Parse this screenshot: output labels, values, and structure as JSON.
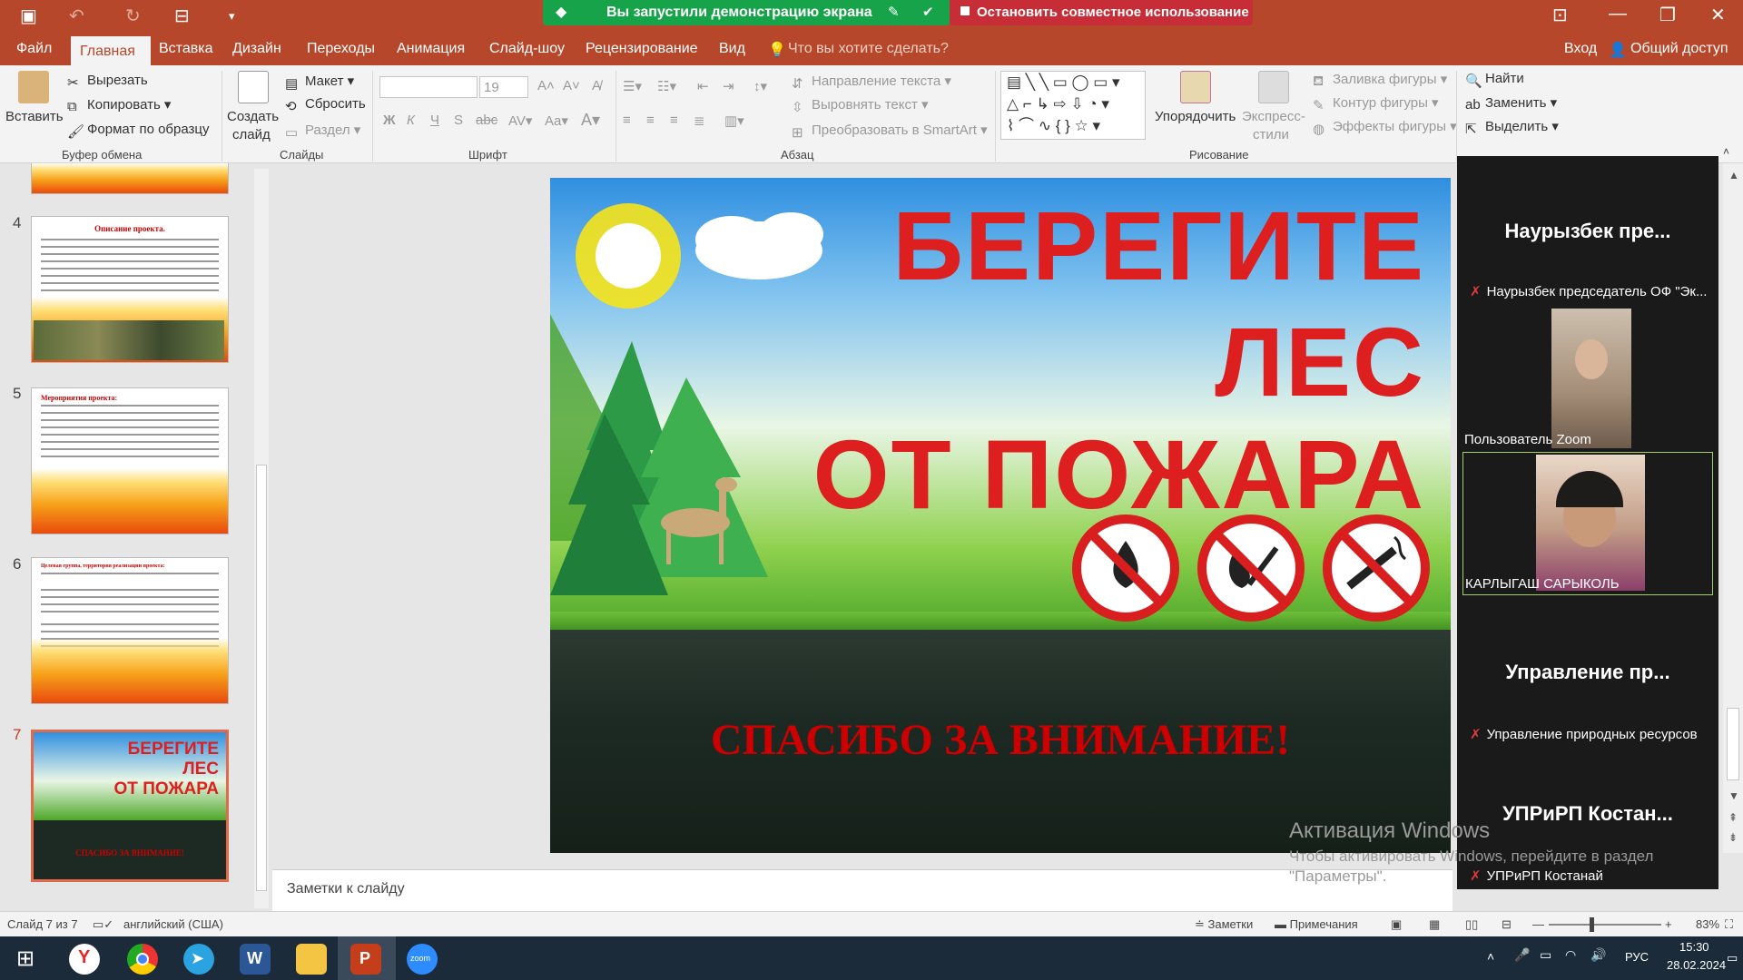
{
  "share_bar": {
    "status": "Вы запустили демонстрацию экрана",
    "stop": "Остановить совместное использование"
  },
  "tabs": [
    "Файл",
    "Главная",
    "Вставка",
    "Дизайн",
    "Переходы",
    "Анимация",
    "Слайд-шоу",
    "Рецензирование",
    "Вид"
  ],
  "tell_me": "Что вы хотите сделать?",
  "account": {
    "login": "Вход",
    "share": "Общий доступ"
  },
  "ribbon": {
    "clipboard": {
      "paste": "Вставить",
      "cut": "Вырезать",
      "copy": "Копировать",
      "format": "Формат по образцу",
      "group": "Буфер обмена"
    },
    "slides": {
      "new_slide": "Создать",
      "new_slide2": "слайд",
      "layout": "Макет",
      "reset": "Сбросить",
      "section": "Раздел",
      "group": "Слайды"
    },
    "font": {
      "size": "19",
      "group": "Шрифт",
      "bold": "Ж",
      "italic": "К",
      "underline": "Ч",
      "shadow": "S",
      "strike": "abc"
    },
    "paragraph": {
      "direction": "Направление текста",
      "align": "Выровнять текст",
      "smartart": "Преобразовать в SmartArt",
      "group": "Абзац"
    },
    "drawing": {
      "arrange": "Упорядочить",
      "styles": "Экспресс-",
      "styles2": "стили",
      "fill": "Заливка фигуры",
      "outline": "Контур фигуры",
      "effects": "Эффекты фигуры",
      "group": "Рисование"
    },
    "editing": {
      "find": "Найти",
      "replace": "Заменить",
      "select": "Выделить"
    }
  },
  "thumbnails": [
    {
      "num": "4",
      "title": "Описание проекта."
    },
    {
      "num": "5",
      "title": "Мероприятия проекта:"
    },
    {
      "num": "6",
      "title": "Целевая группа, территория реализации проекта:"
    },
    {
      "num": "7"
    }
  ],
  "slide": {
    "line1": "БЕРЕГИТЕ",
    "line2": "ЛЕС",
    "line3": "ОТ ПОЖАРА",
    "thanks": "СПАСИБО ЗА ВНИМАНИЕ!"
  },
  "notes_placeholder": "Заметки к слайду",
  "zoom": {
    "p1_name": "Наурызбек пре...",
    "p1_label": "Наурызбек председатель ОФ \"Эк...",
    "p2_label": "Пользователь Zoom",
    "p3_label": "КАРЛЫГАШ САРЫКОЛЬ",
    "p4_name": "Управление пр...",
    "p4_label": "Управление природных ресурсов",
    "p5_name": "УПРиРП Костан...",
    "p5_label": "УПРиРП Костанай"
  },
  "watermark": {
    "line1": "Активация Windows",
    "line2": "Чтобы активировать Windows, перейдите в раздел",
    "line3": "\"Параметры\"."
  },
  "status": {
    "slide": "Слайд 7 из 7",
    "lang": "английский (США)",
    "notes": "Заметки",
    "comments": "Примечания",
    "zoom": "83%"
  },
  "taskbar": {
    "lang": "РУС",
    "time": "15:30",
    "date": "28.02.2024"
  },
  "colors": {
    "accent": "#b7472a",
    "share_green": "#17a34a",
    "stop_red": "#c62d36",
    "title_red": "#dd1f1f"
  }
}
